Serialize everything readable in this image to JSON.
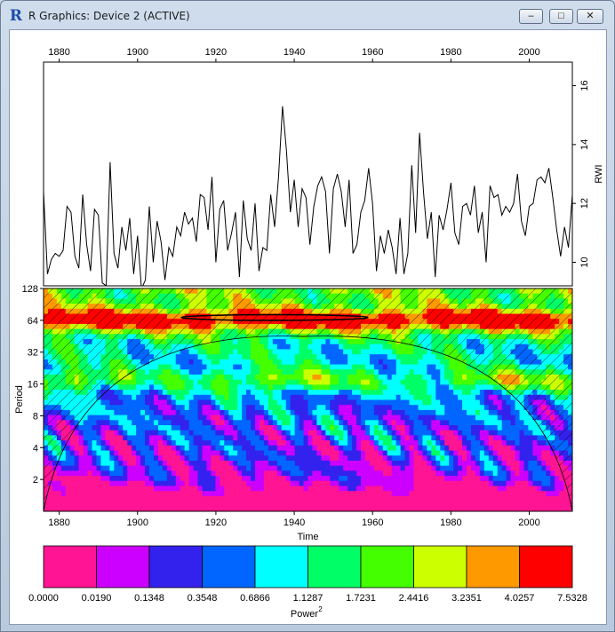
{
  "window": {
    "title": "R Graphics: Device 2 (ACTIVE)",
    "icon": "r-logo-icon",
    "buttons": {
      "minimize": "–",
      "maximize": "□",
      "close": "✕"
    }
  },
  "chart_data": [
    {
      "type": "line",
      "title": "",
      "xlabel": "",
      "ylabel": "RWI",
      "xlim": [
        1876,
        2011
      ],
      "ylim": [
        9.2,
        16.8
      ],
      "x_ticks": [
        1880,
        1900,
        1920,
        1940,
        1960,
        1980,
        2000
      ],
      "y_ticks": [
        10,
        12,
        14,
        16
      ],
      "series": [
        {
          "x": [
            1876,
            1877,
            1878,
            1879,
            1880,
            1881,
            1882,
            1883,
            1884,
            1885,
            1886,
            1887,
            1888,
            1889,
            1890,
            1891,
            1892,
            1893,
            1894,
            1895,
            1896,
            1897,
            1898,
            1899,
            1900,
            1901,
            1902,
            1903,
            1904,
            1905,
            1906,
            1907,
            1908,
            1909,
            1910,
            1911,
            1912,
            1913,
            1914,
            1915,
            1916,
            1917,
            1918,
            1919,
            1920,
            1921,
            1922,
            1923,
            1924,
            1925,
            1926,
            1927,
            1928,
            1929,
            1930,
            1931,
            1932,
            1933,
            1934,
            1935,
            1936,
            1937,
            1938,
            1939,
            1940,
            1941,
            1942,
            1943,
            1944,
            1945,
            1946,
            1947,
            1948,
            1949,
            1950,
            1951,
            1952,
            1953,
            1954,
            1955,
            1956,
            1957,
            1958,
            1959,
            1960,
            1961,
            1962,
            1963,
            1964,
            1965,
            1966,
            1967,
            1968,
            1969,
            1970,
            1971,
            1972,
            1973,
            1974,
            1975,
            1976,
            1977,
            1978,
            1979,
            1980,
            1981,
            1982,
            1983,
            1984,
            1985,
            1986,
            1987,
            1988,
            1989,
            1990,
            1991,
            1992,
            1993,
            1994,
            1995,
            1996,
            1997,
            1998,
            1999,
            2000,
            2001,
            2002,
            2003,
            2004,
            2005,
            2006,
            2007,
            2008,
            2009,
            2010,
            2011
          ],
          "values": [
            12.4,
            9.6,
            10.1,
            10.3,
            10.2,
            10.4,
            11.9,
            11.7,
            10.2,
            9.8,
            12.3,
            10.6,
            9.7,
            11.8,
            11.6,
            9.3,
            9.2,
            13.4,
            10.3,
            9.8,
            11.2,
            10.4,
            11.5,
            9.6,
            10.9,
            9.1,
            9.4,
            11.9,
            10.0,
            11.4,
            10.7,
            9.4,
            10.5,
            10.2,
            11.2,
            10.9,
            11.7,
            11.3,
            11.5,
            10.7,
            12.3,
            12.2,
            11.1,
            12.9,
            10.0,
            11.8,
            12.1,
            10.4,
            11.0,
            11.7,
            9.5,
            12.1,
            10.8,
            10.4,
            12.0,
            9.7,
            10.5,
            10.4,
            12.3,
            11.2,
            12.9,
            15.3,
            13.8,
            11.7,
            12.8,
            11.2,
            12.5,
            12.2,
            10.6,
            11.9,
            12.6,
            12.9,
            12.4,
            10.3,
            12.5,
            13.0,
            12.4,
            11.2,
            12.8,
            10.3,
            10.6,
            11.7,
            12.1,
            13.2,
            12.0,
            9.7,
            10.9,
            10.3,
            11.1,
            10.5,
            9.6,
            11.5,
            9.6,
            10.3,
            13.3,
            11.0,
            14.4,
            12.4,
            10.8,
            11.7,
            9.5,
            11.6,
            11.1,
            11.8,
            12.7,
            11.0,
            10.6,
            11.9,
            12.0,
            11.6,
            12.6,
            11.0,
            11.7,
            10.0,
            12.6,
            12.2,
            12.3,
            11.6,
            11.9,
            11.7,
            12.0,
            13.0,
            11.4,
            10.9,
            11.9,
            12.0,
            12.8,
            12.9,
            12.7,
            13.2,
            12.2,
            11.1,
            10.2,
            11.2,
            10.5,
            12.3
          ]
        }
      ]
    },
    {
      "type": "heatmap",
      "title": "",
      "xlabel": "Time",
      "ylabel": "Period",
      "xlim": [
        1876,
        2011
      ],
      "y_scale": "log2",
      "ylim": [
        1,
        128
      ],
      "x_ticks": [
        1880,
        1900,
        1920,
        1940,
        1960,
        1980,
        2000
      ],
      "y_ticks": [
        2,
        4,
        8,
        16,
        32,
        64,
        128
      ],
      "cone_of_influence": "hatched",
      "significance_contour": "black",
      "legend": {
        "title": "Power",
        "title_superscript": "2",
        "placement": "bottom",
        "colors": [
          "#ff1493",
          "#cc00ff",
          "#3322ee",
          "#0066ff",
          "#00ffff",
          "#00ff66",
          "#44ff00",
          "#ccff00",
          "#ff9900",
          "#ff0000"
        ],
        "breaks": [
          "0.0000",
          "0.0190",
          "0.1348",
          "0.3548",
          "0.6866",
          "1.1287",
          "1.7231",
          "2.4416",
          "3.2351",
          "4.0257",
          "7.5328"
        ]
      }
    }
  ]
}
